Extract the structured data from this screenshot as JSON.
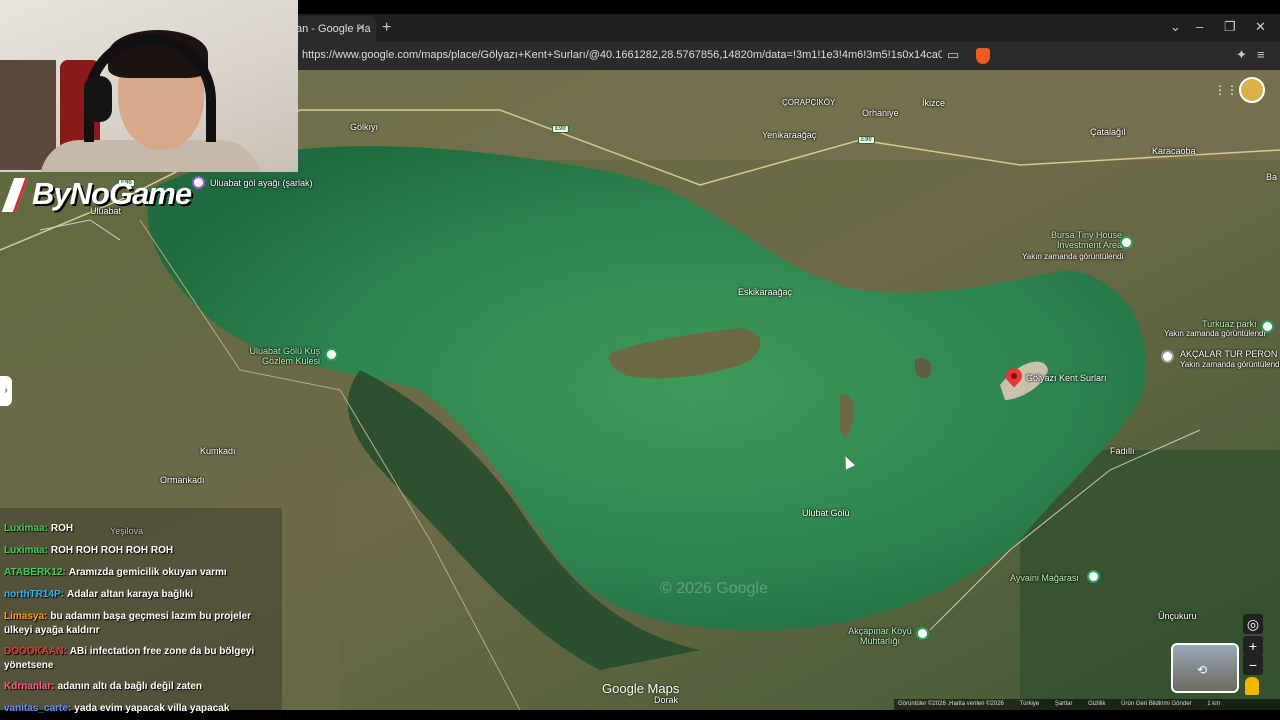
{
  "browser": {
    "tab_title": "an - Google Ha",
    "tab_close": "×",
    "new_tab": "+",
    "url": "https://www.google.com/maps/place/Gölyazı+Kent+Surları/@40.1661282,28.5767856,14820m/data=!3m1!1e3!4m6!3m5!1s0x14ca07646fa467a5:0xcb98f...",
    "window_controls": [
      "⌄",
      "–",
      "❐",
      "✕"
    ]
  },
  "stream": {
    "logo_text": "ByNoGame"
  },
  "map": {
    "labels": [
      {
        "text": "ÇORAPÇIKÖY",
        "cls": "small"
      },
      {
        "text": "İkizce"
      },
      {
        "text": "Orhaniye"
      },
      {
        "text": "Gölkıyı"
      },
      {
        "text": "Yenikaraağaç"
      },
      {
        "text": "Çatalağıl"
      },
      {
        "text": "Karacaoba"
      },
      {
        "text": "Uluabat"
      },
      {
        "text": "Uluabat göl ayağı (şarlak)"
      },
      {
        "text": "Bursa Tiny House Investment Area",
        "cls": "green"
      },
      {
        "text": "Yakın zamanda görüntülendi",
        "cls": "small"
      },
      {
        "text": "Eskikaraağaç"
      },
      {
        "text": "Turkuaz parkı",
        "cls": "green"
      },
      {
        "text": "Yakın zamanda görüntülendi",
        "cls": "small"
      },
      {
        "text": "AKÇALAR TUR PERON"
      },
      {
        "text": "Yakın zamanda görüntülendi",
        "cls": "small"
      },
      {
        "text": "Uluabat Gölü Kuş Gözlem Kulesi",
        "cls": "green"
      },
      {
        "text": "Gölyazı Kent Surları"
      },
      {
        "text": "Fadıllı"
      },
      {
        "text": "Kumkadı"
      },
      {
        "text": "Ormankadı"
      },
      {
        "text": "Ulubat Gölü"
      },
      {
        "text": "Ayvaini Mağarası",
        "cls": "green"
      },
      {
        "text": "Akçapınar Köyü Muhtarlığı",
        "cls": "green"
      },
      {
        "text": "Ünçukuru"
      },
      {
        "text": "Dorak"
      },
      {
        "text": "Yeşilova"
      },
      {
        "text": "Ba"
      }
    ],
    "road_shields": [
      "E90",
      "E90",
      "E90"
    ],
    "watermark": "© 2026 Google",
    "brand": "Google Maps",
    "attribution": [
      "Görüntüler ©2026 ,Harita verileri ©2026",
      "Türkiye",
      "Şartlar",
      "Gizlilik",
      "Ürün Geri Bildirimi Gönder",
      "1 km"
    ],
    "zoom_in": "+",
    "zoom_out": "−",
    "locate": "◎",
    "side_handle": "›",
    "apps_icon": "⋮⋮⋮"
  },
  "chat": {
    "messages": [
      {
        "user": "Luximaa:",
        "text": "ROH",
        "color": "#39d353"
      },
      {
        "user": "Luximaa:",
        "text": "ROH ROH ROH ROH ROH",
        "color": "#39d353"
      },
      {
        "user": "ATABERK12:",
        "text": "Aramızda gemicilik okuyan varmı",
        "color": "#39d353"
      },
      {
        "user": "northTR14P:",
        "text": "Adalar altan karaya bağlıki",
        "color": "#29b6f6"
      },
      {
        "user": "Limasya:",
        "text": "bu adamın başa geçmesi lazım bu projeler ülkeyi ayağa kaldırır",
        "color": "#ff9e1b"
      },
      {
        "user": "DOOOKAAN:",
        "text": "ABi infectation free zone da bu bölgeyi yönetsene",
        "color": "#e53935"
      },
      {
        "user": "Kdrnanlar:",
        "text": "adanın altı da bağlı değil zaten",
        "color": "#ff5c8a"
      },
      {
        "user": "vanitas_carte:",
        "text": "yada evim yapacak villa yapacak",
        "color": "#6a8cff"
      }
    ]
  }
}
